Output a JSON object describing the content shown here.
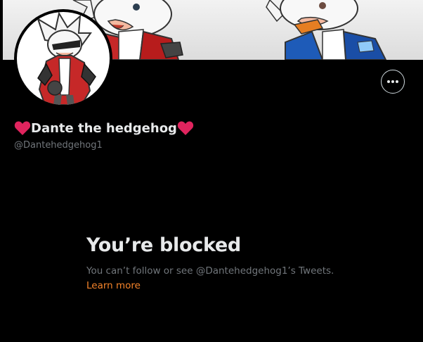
{
  "profile": {
    "display_name": "Dante the hedgehog",
    "handle": "@Dantehedgehog1",
    "name_decoration_icon": "red-heart-icon"
  },
  "actions": {
    "more_icon": "more-options-icon"
  },
  "blocked": {
    "title": "You’re blocked",
    "description": "You can’t follow or see @Dantehedgehog1’s Tweets.",
    "learn_more": "Learn more"
  },
  "colors": {
    "background": "#000000",
    "primary_text": "#e7e9ea",
    "secondary_text": "#71767b",
    "link": "#f4832a",
    "heart": "#e0245e"
  }
}
